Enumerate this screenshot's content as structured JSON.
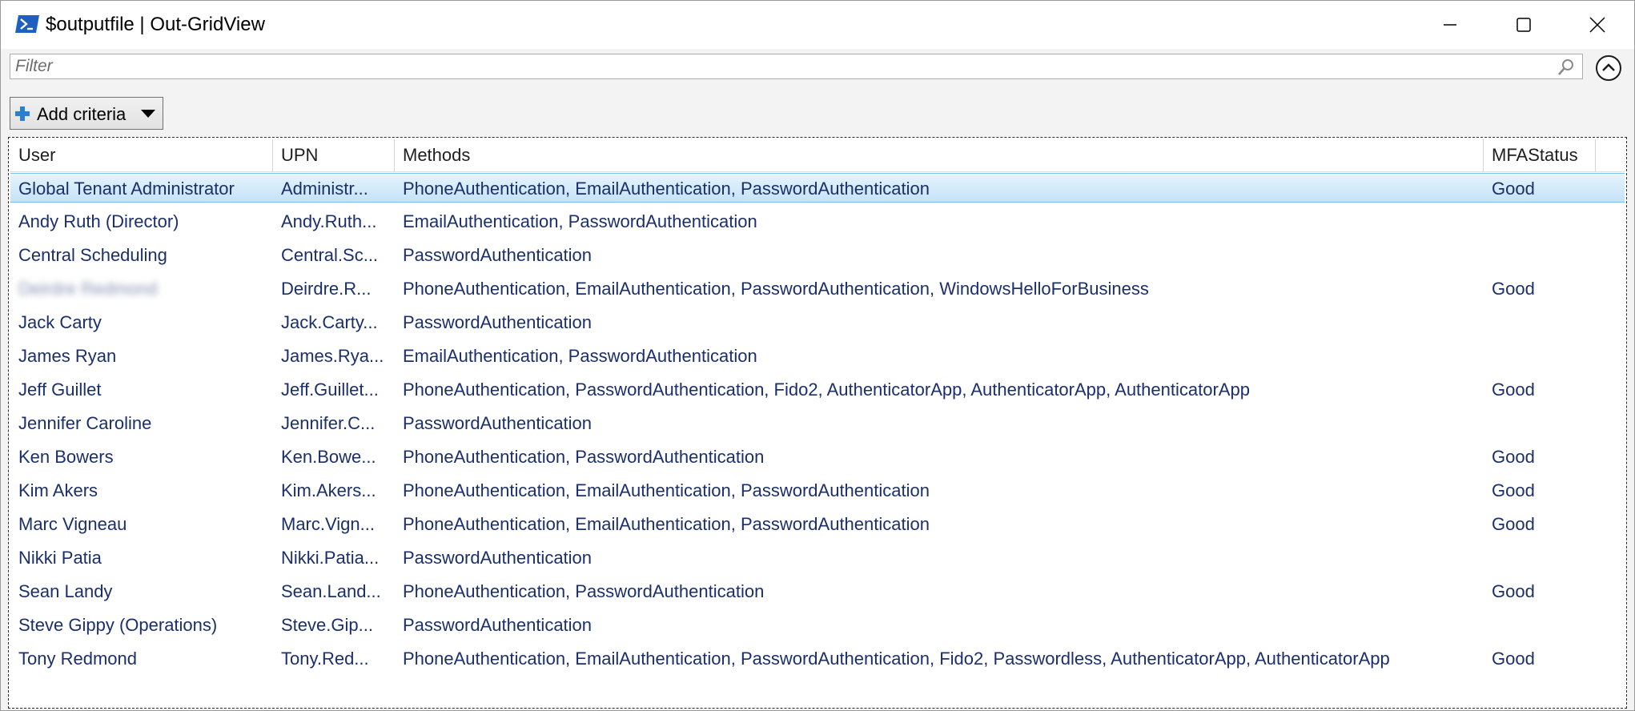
{
  "window": {
    "title": "$outputfile | Out-GridView",
    "app_icon": "powershell-icon",
    "controls": {
      "minimize_icon": "minimize-icon",
      "maximize_icon": "maximize-icon",
      "close_icon": "close-icon"
    }
  },
  "filter": {
    "placeholder": "Filter",
    "value": "",
    "search_icon": "search-icon",
    "collapse_icon": "chevron-up-circle-icon"
  },
  "toolbar": {
    "add_criteria_label": "Add criteria",
    "add_icon": "plus-icon",
    "dropdown_icon": "triangle-down-icon"
  },
  "grid": {
    "columns": [
      "User",
      "UPN",
      "Methods",
      "MFAStatus"
    ],
    "selected_row": 0,
    "rows": [
      {
        "user": "Global Tenant Administrator",
        "upn": "Administr...",
        "methods": "PhoneAuthentication, EmailAuthentication, PasswordAuthentication",
        "mfa": "Good"
      },
      {
        "user": "Andy Ruth (Director)",
        "upn": "Andy.Ruth...",
        "methods": "EmailAuthentication, PasswordAuthentication",
        "mfa": ""
      },
      {
        "user": "Central Scheduling",
        "upn": "Central.Sc...",
        "methods": "PasswordAuthentication",
        "mfa": ""
      },
      {
        "user": "Deirdre Redmond",
        "upn": "Deirdre.R...",
        "methods": "PhoneAuthentication, EmailAuthentication, PasswordAuthentication, WindowsHelloForBusiness",
        "mfa": "Good",
        "blurred": true
      },
      {
        "user": "Jack Carty",
        "upn": "Jack.Carty...",
        "methods": "PasswordAuthentication",
        "mfa": ""
      },
      {
        "user": "James Ryan",
        "upn": "James.Rya...",
        "methods": "EmailAuthentication, PasswordAuthentication",
        "mfa": ""
      },
      {
        "user": "Jeff Guillet",
        "upn": "Jeff.Guillet...",
        "methods": "PhoneAuthentication, PasswordAuthentication, Fido2, AuthenticatorApp, AuthenticatorApp, AuthenticatorApp",
        "mfa": "Good"
      },
      {
        "user": "Jennifer Caroline",
        "upn": "Jennifer.C...",
        "methods": "PasswordAuthentication",
        "mfa": ""
      },
      {
        "user": "Ken Bowers",
        "upn": "Ken.Bowe...",
        "methods": "PhoneAuthentication, PasswordAuthentication",
        "mfa": "Good"
      },
      {
        "user": "Kim Akers",
        "upn": "Kim.Akers...",
        "methods": "PhoneAuthentication, EmailAuthentication, PasswordAuthentication",
        "mfa": "Good"
      },
      {
        "user": "Marc Vigneau",
        "upn": "Marc.Vign...",
        "methods": "PhoneAuthentication, EmailAuthentication, PasswordAuthentication",
        "mfa": "Good"
      },
      {
        "user": "Nikki Patia",
        "upn": "Nikki.Patia...",
        "methods": "PasswordAuthentication",
        "mfa": ""
      },
      {
        "user": "Sean Landy",
        "upn": "Sean.Land...",
        "methods": "PhoneAuthentication, PasswordAuthentication",
        "mfa": "Good"
      },
      {
        "user": "Steve Gippy (Operations)",
        "upn": "Steve.Gip...",
        "methods": "PasswordAuthentication",
        "mfa": ""
      },
      {
        "user": "Tony Redmond",
        "upn": "Tony.Red...",
        "methods": "PhoneAuthentication, EmailAuthentication, PasswordAuthentication, Fido2, Passwordless, AuthenticatorApp, AuthenticatorApp",
        "mfa": "Good"
      }
    ]
  },
  "colors": {
    "text_row": "#1b2f6b",
    "selection_bg": "#c3e3f8",
    "selection_border": "#7ec0ec",
    "icon_blue": "#1f5fbf"
  }
}
